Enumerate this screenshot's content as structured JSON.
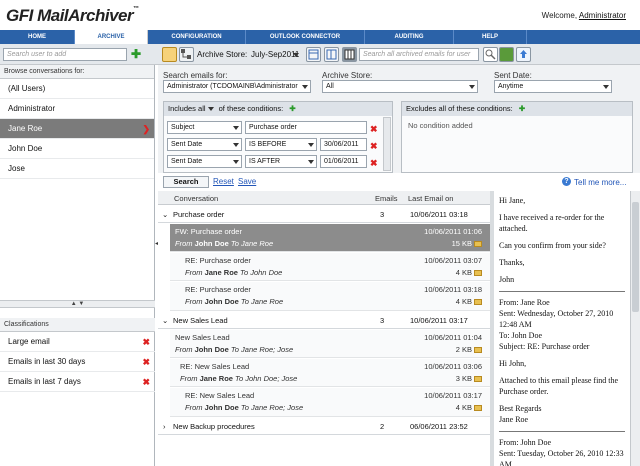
{
  "app": {
    "logo_gfi": "GFI",
    "logo_name": "MailArchiver",
    "logo_tm": "™"
  },
  "welcome": {
    "text": "Welcome,",
    "user": "Administrator"
  },
  "nav": [
    "HOME",
    "ARCHIVE",
    "CONFIGURATION",
    "OUTLOOK CONNECTOR",
    "AUDITING",
    "HELP"
  ],
  "toolbar": {
    "user_search_placeholder": "Search user to add",
    "archive_store_label": "Archive Store:",
    "archive_store_value": "July-Sep2011",
    "email_search_placeholder": "Search all archived emails for user"
  },
  "left": {
    "browse_label": "Browse conversations for:",
    "users": [
      "(All Users)",
      "Administrator",
      "Jane Roe",
      "John Doe",
      "Jose"
    ],
    "selected_user_index": 2,
    "classifications_label": "Classifications",
    "classifications": [
      "Large email",
      "Emails in last 30 days",
      "Emails in last 7 days"
    ]
  },
  "filter": {
    "search_emails_for_label": "Search emails for:",
    "search_emails_for_value": "Administrator (TCDOMAINB\\Administrator",
    "archive_store_label": "Archive Store:",
    "archive_store_value": "All",
    "sent_date_label": "Sent Date:",
    "sent_date_value": "Anytime",
    "includes_prefix": "Includes",
    "includes_mode": "all",
    "includes_suffix": "of these conditions:",
    "excludes_label": "Excludes all of these conditions:",
    "no_condition": "No condition added",
    "conditions": [
      {
        "field": "Subject",
        "value": "Purchase order"
      },
      {
        "field": "Sent Date",
        "op": "IS BEFORE",
        "value": "30/06/2011"
      },
      {
        "field": "Sent Date",
        "op": "IS AFTER",
        "value": "01/06/2011"
      }
    ],
    "search_button": "Search",
    "reset_link": "Reset",
    "save_link": "Save",
    "tell_me_more": "Tell me more..."
  },
  "list": {
    "columns": {
      "conversation": "Conversation",
      "emails": "Emails",
      "last_email": "Last Email on"
    },
    "groups": [
      {
        "subject": "Purchase order",
        "count": "3",
        "date": "10/06/2011 03:18",
        "expanded": true,
        "messages": [
          {
            "subject": "FW: Purchase order",
            "date": "10/06/2011 01:06",
            "from_label": "From",
            "from": "John Doe",
            "to_label": "To",
            "to": "Jane Roe",
            "size": "15 KB"
          },
          {
            "subject": "RE: Purchase order",
            "date": "10/06/2011 03:07",
            "from_label": "From",
            "from": "Jane Roe",
            "to_label": "To",
            "to": "John Doe",
            "size": "4 KB"
          },
          {
            "subject": "RE: Purchase order",
            "date": "10/06/2011 03:18",
            "from_label": "From",
            "from": "John Doe",
            "to_label": "To",
            "to": "Jane Roe",
            "size": "4 KB"
          }
        ]
      },
      {
        "subject": "New Sales Lead",
        "count": "3",
        "date": "10/06/2011 03:17",
        "expanded": true,
        "messages": [
          {
            "subject": "New Sales Lead",
            "date": "10/06/2011 01:04",
            "from_label": "From",
            "from": "John Doe",
            "to_label": "To",
            "to": "Jane Roe; Jose",
            "size": "2 KB"
          },
          {
            "subject": "RE: New Sales Lead",
            "date": "10/06/2011 03:06",
            "from_label": "From",
            "from": "Jane Roe",
            "to_label": "To",
            "to": "John Doe; Jose",
            "size": "3 KB"
          },
          {
            "subject": "RE: New Sales Lead",
            "date": "10/06/2011 03:17",
            "from_label": "From",
            "from": "John Doe",
            "to_label": "To",
            "to": "Jane Roe; Jose",
            "size": "4 KB"
          }
        ]
      },
      {
        "subject": "New Backup procedures",
        "count": "2",
        "date": "06/06/2011 23:52",
        "expanded": false,
        "messages": []
      }
    ]
  },
  "preview": {
    "greeting": "Hi Jane,",
    "p1": "I have received a re-order for the attached.",
    "p2": "Can you confirm from your side?",
    "p3": "Thanks,",
    "p4": "John",
    "quote_from": "From: Jane Roe",
    "quote_sent": "Sent: Wednesday, October 27, 2010 12:48 AM",
    "quote_to": "To: John Doe",
    "quote_subject": "Subject: RE: Purchase order",
    "q_greeting": "Hi John,",
    "q_body": "Attached to this email please find the Purchase order.",
    "q_regards": "Best Regards",
    "q_name": "Jane Roe",
    "quote2_from": "From: John Doe",
    "quote2_sent": "Sent: Tuesday, October 26, 2010 12:33 AM"
  },
  "colors": {
    "nav_bg": "#2b62a8",
    "selected_row": "#7b7b7b",
    "link": "#2256b8",
    "delete": "#dd2222",
    "add": "#2a9a2a"
  }
}
